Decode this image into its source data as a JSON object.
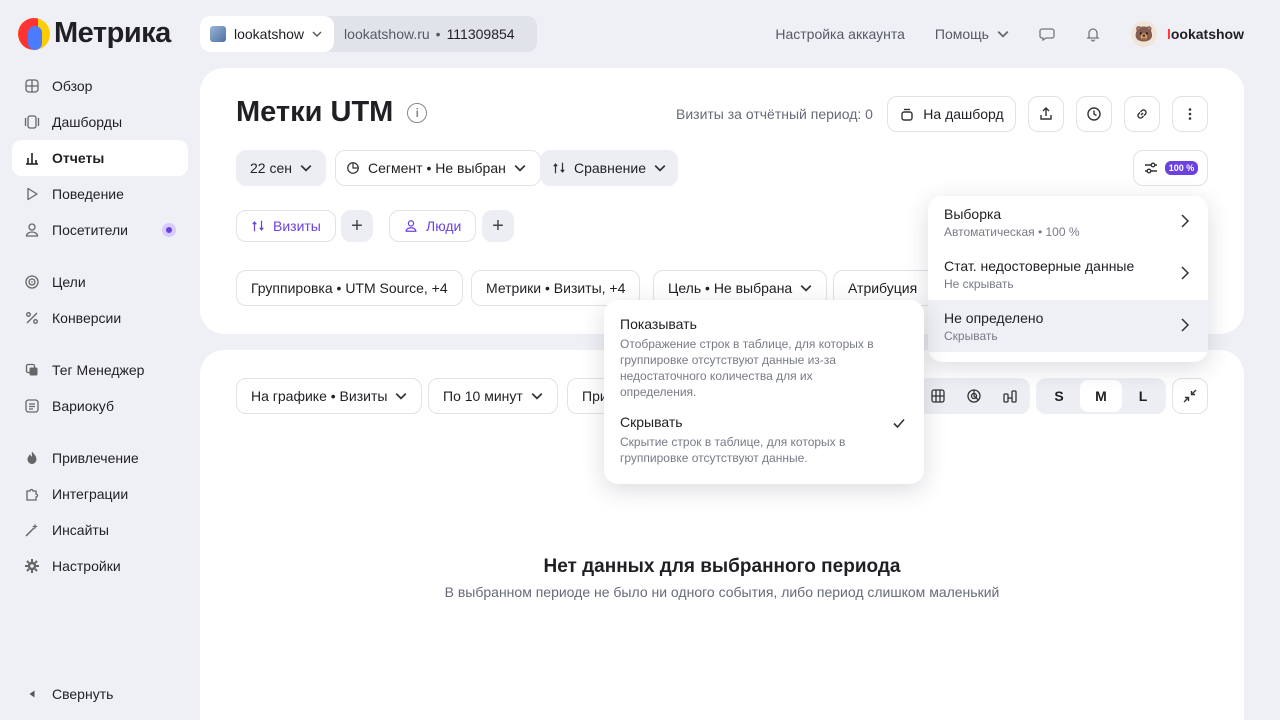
{
  "header": {
    "logo_text": "Метрика",
    "site_name": "lookatshow",
    "site_domain": "lookatshow.ru",
    "counter_id": "111309854",
    "account_settings": "Настройка аккаунта",
    "help": "Помощь",
    "user_first_letter": "l",
    "user_rest": "ookatshow"
  },
  "sidebar": {
    "items": [
      {
        "label": "Обзор"
      },
      {
        "label": "Дашборды"
      },
      {
        "label": "Отчеты"
      },
      {
        "label": "Поведение"
      },
      {
        "label": "Посетители"
      },
      {
        "label": "Цели"
      },
      {
        "label": "Конверсии"
      },
      {
        "label": "Тег Менеджер"
      },
      {
        "label": "Вариокуб"
      },
      {
        "label": "Привлечение"
      },
      {
        "label": "Интеграции"
      },
      {
        "label": "Инсайты"
      },
      {
        "label": "Настройки"
      }
    ],
    "collapse": "Свернуть"
  },
  "report": {
    "title": "Метки UTM",
    "visits_period": "Визиты за отчётный период: 0",
    "to_dashboard": "На дашборд",
    "date": "22 сен",
    "segment": "Сегмент • Не выбран",
    "compare": "Сравнение",
    "sample_badge": "100 %",
    "chip_visits": "Визиты",
    "chip_people": "Люди",
    "grouping": "Группировка • UTM Source, +4",
    "metrics": "Метрики • Визиты, +4",
    "goal": "Цель • Не выбрана",
    "attribution": "Атрибуция"
  },
  "chart": {
    "on_chart": "На графике • Визиты",
    "interval": "По 10 минут",
    "third": "При",
    "size_s": "S",
    "size_m": "M",
    "size_l": "L",
    "empty_title": "Нет данных для выбранного периода",
    "empty_sub": "В выбранном периоде не было ни одного события, либо период слишком маленький"
  },
  "settings_menu": {
    "items": [
      {
        "title": "Выборка",
        "sub": "Автоматическая • 100 %"
      },
      {
        "title": "Стат. недостоверные данные",
        "sub": "Не скрывать"
      },
      {
        "title": "Не определено",
        "sub": "Скрывать"
      }
    ]
  },
  "undefined_menu": {
    "show_title": "Показывать",
    "show_desc": "Отображение строк в таблице, для которых в группировке отсутствуют данные из-за недостаточного количества для их определения.",
    "hide_title": "Скрывать",
    "hide_desc": "Скрытие строк в таблице, для которых в группировке отсутствуют данные."
  }
}
